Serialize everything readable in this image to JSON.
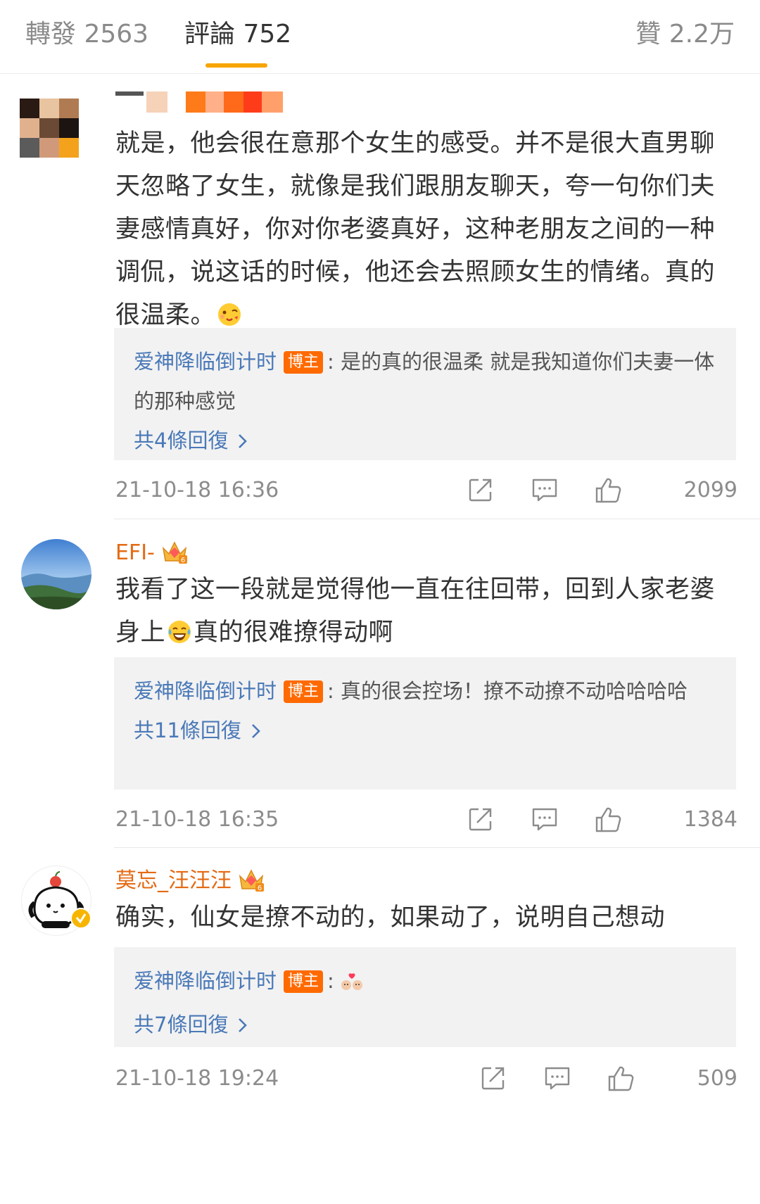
{
  "tabs": {
    "reposts": "轉發 2563",
    "comments": "評論 752",
    "likes": "贊 2.2万"
  },
  "colors": {
    "accent": "#f7a500",
    "username": "#e46a13",
    "link": "#4a79b8",
    "badge": "#ff6a00"
  },
  "comments": [
    {
      "username": "",
      "text": "就是，他会很在意那个女生的感受。并不是很大直男聊天忽略了女生，就像是我们跟朋友聊天，夸一句你们夫妻感情真好，你对你老婆真好，这种老朋友之间的一种调侃，说这话的时候，他还会去照顾女生的情绪。真的很温柔。",
      "emoji": "face-blowing-kiss-icon",
      "reply": {
        "author": "爱神降临倒计时",
        "badge": "博主",
        "text": ": 是的真的很温柔 就是我知道你们夫妻一体的那种感觉",
        "more": "共4條回復"
      },
      "time": "21-10-18 16:36",
      "likes": "2099"
    },
    {
      "username": "EFI-",
      "text_a": "我看了这一段就是觉得他一直在往回带，回到人家老婆身上",
      "text_b": "真的很难撩得动啊",
      "emoji": "laughing-tears-icon",
      "reply": {
        "author": "爱神降临倒计时",
        "badge": "博主",
        "text": ": 真的很会控场！撩不动撩不动哈哈哈哈",
        "more": "共11條回復"
      },
      "time": "21-10-18 16:35",
      "likes": "1384"
    },
    {
      "username": "莫忘_汪汪汪",
      "text": "确实，仙女是撩不动的，如果动了，说明自己想动",
      "reply": {
        "author": "爱神降临倒计时",
        "badge": "博主",
        "text": ":",
        "emoji": "couple-hearts-icon",
        "more": "共7條回復"
      },
      "time": "21-10-18 19:24",
      "likes": "509"
    }
  ]
}
